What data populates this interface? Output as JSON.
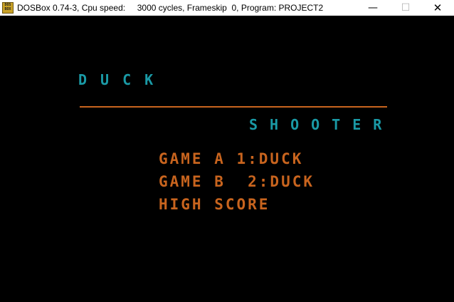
{
  "window": {
    "app_icon_text": "DOS BOX",
    "title": "DOSBox 0.74-3, Cpu speed:     3000 cycles, Frameskip  0, Program: PROJECT2",
    "minimize_glyph": "—",
    "maximize_glyph": "☐",
    "close_glyph": "✕"
  },
  "game": {
    "title_top": "DUCK",
    "title_bottom": "SHOOTER",
    "menu": [
      "GAME A 1:DUCK",
      "GAME B  2:DUCK",
      "HIGH SCORE"
    ]
  },
  "colors": {
    "title_cyan": "#1a9aa6",
    "menu_orange": "#c8641e",
    "background": "#000000"
  }
}
